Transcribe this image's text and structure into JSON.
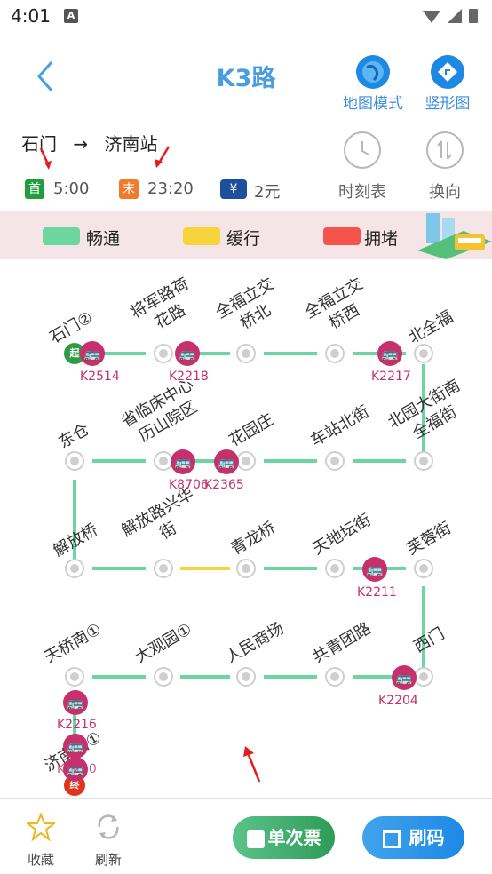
{
  "status_bar": {
    "time": "4:01",
    "notif_icon": "A"
  },
  "header": {
    "title": "K3路",
    "map_mode_label": "地图模式",
    "vertical_label": "竖形图"
  },
  "route": {
    "from": "石门",
    "arrow": "→",
    "to": "济南站",
    "first_tag": "首",
    "first_time": "5:00",
    "last_tag": "末",
    "last_time": "23:20",
    "fare_icon": "¥",
    "fare": "2元",
    "timetable_label": "时刻表",
    "reverse_label": "换向"
  },
  "legend": {
    "smooth": "畅通",
    "slow": "缓行",
    "jam": "拥堵",
    "colors": {
      "smooth": "#6dd5a0",
      "slow": "#f7d43c",
      "jam": "#f5544a"
    }
  },
  "stations": {
    "s1": "石门②",
    "s2": "将军路荷花路",
    "s3": "全福立交桥北",
    "s4": "全福立交桥西",
    "s5": "北全福",
    "s6": "北园大街南全福街",
    "s7": "车站北街",
    "s8": "花园庄",
    "s9": "省临床中心历山院区",
    "s10": "东仓",
    "s11": "解放桥",
    "s12": "解放路兴华街",
    "s13": "青龙桥",
    "s14": "天地坛街",
    "s15": "芙蓉街",
    "s16": "西门",
    "s17": "共青团路",
    "s18": "人民商场",
    "s19": "大观园①",
    "s20": "天桥南①",
    "s21": "济南站①"
  },
  "buses": {
    "b1": "K2514",
    "b2": "K2218",
    "b3": "K2217",
    "b4": "K8706",
    "b5": "K2365",
    "b6": "K2211",
    "b7": "K2204",
    "b8": "K2216",
    "b9": "K2210"
  },
  "markers": {
    "start": "起",
    "end": "终"
  },
  "bottom": {
    "favorite_label": "收藏",
    "refresh_label": "刷新",
    "single_ticket_label": "单次票",
    "scan_code_label": "刷码"
  }
}
